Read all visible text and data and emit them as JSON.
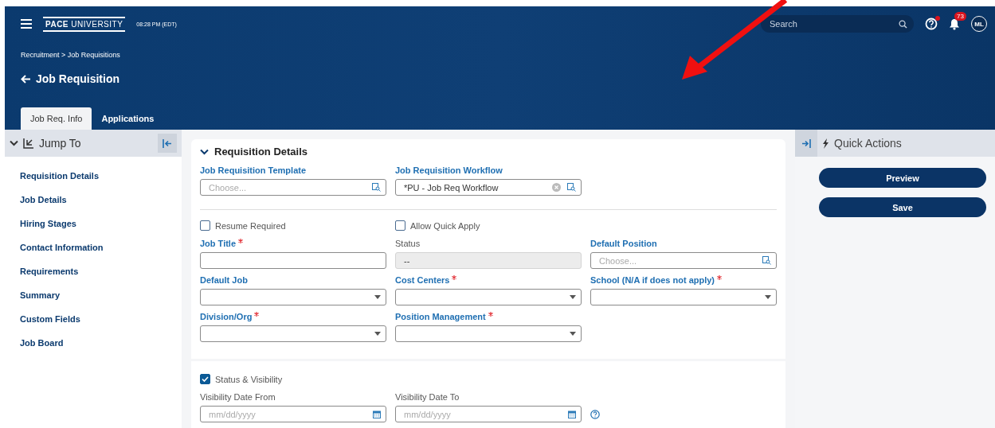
{
  "header": {
    "time": "08:28 PM (EDT)",
    "logo": {
      "bold": "PACE",
      "rest": "UNIVERSITY"
    },
    "search": {
      "placeholder": "Search"
    },
    "help_alert": true,
    "notifications": "73",
    "avatar": "ML",
    "breadcrumb": "Recruitment > Job Requisitions",
    "title": "Job Requisition"
  },
  "tabs": [
    {
      "label": "Job Req. Info",
      "selected": true
    },
    {
      "label": "Applications",
      "selected": false
    }
  ],
  "sidebar": {
    "title": "Jump To",
    "expanded": true,
    "items": [
      "Requisition Details",
      "Job Details",
      "Hiring Stages",
      "Contact Information",
      "Requirements",
      "Summary",
      "Custom Fields",
      "Job Board"
    ]
  },
  "section": {
    "title": "Requisition Details",
    "expanded": true,
    "rows": [
      {
        "kind": "fields",
        "items": [
          {
            "kind": "lookup",
            "label": "Job Requisition Template",
            "required": false,
            "placeholder": "Choose..."
          },
          {
            "kind": "lookup",
            "label": "Job Requisition Workflow",
            "required": false,
            "value": "*PU - Job Req Workflow",
            "clearable": true
          }
        ]
      },
      {
        "kind": "divider"
      },
      {
        "kind": "fields",
        "items": [
          {
            "kind": "checkbox",
            "label": "Resume Required",
            "checked": false
          },
          {
            "kind": "checkbox",
            "label": "Allow Quick Apply",
            "checked": false
          }
        ]
      },
      {
        "kind": "fields",
        "items": [
          {
            "kind": "text",
            "label": "Job Title",
            "required": true
          },
          {
            "kind": "text",
            "label": "Status",
            "required": false,
            "value": "--",
            "disabled": true
          },
          {
            "kind": "lookup",
            "label": "Default Position",
            "required": false,
            "placeholder": "Choose..."
          }
        ]
      },
      {
        "kind": "fields",
        "items": [
          {
            "kind": "select",
            "label": "Default Job",
            "required": false
          },
          {
            "kind": "select",
            "label": "Cost Centers",
            "required": true
          },
          {
            "kind": "select",
            "label": "School (N/A if does not apply)",
            "required": true
          }
        ]
      },
      {
        "kind": "fields",
        "items": [
          {
            "kind": "select",
            "label": "Division/Org",
            "required": true
          },
          {
            "kind": "select",
            "label": "Position Management",
            "required": true
          }
        ]
      }
    ]
  },
  "visibility": {
    "label": "Status & Visibility",
    "checked": true,
    "help": true,
    "fields": [
      {
        "kind": "date",
        "label": "Visibility Date From",
        "required": false,
        "placeholder": "mm/dd/yyyy",
        "plain": true
      },
      {
        "kind": "date",
        "label": "Visibility Date To",
        "required": false,
        "placeholder": "mm/dd/yyyy",
        "plain": true
      }
    ]
  },
  "quick_actions": {
    "title": "Quick Actions",
    "buttons": [
      "Preview",
      "Save"
    ]
  }
}
